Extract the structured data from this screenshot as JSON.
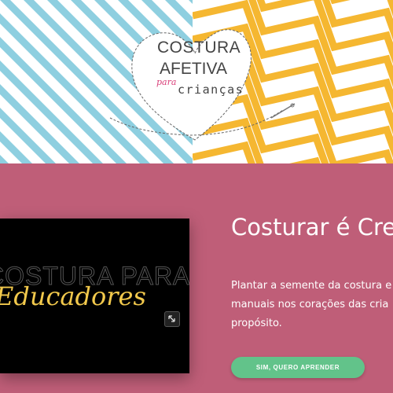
{
  "hero": {
    "logo": {
      "line1": "COSTURA",
      "line2": "AFETIVA",
      "line3": "para",
      "line4": "crianças"
    },
    "colors": {
      "stripes_left": "#8ecfe0",
      "stripes_right": "#f5b731",
      "heart_line": "#555555"
    }
  },
  "video": {
    "title_top": "COSTURA PARA",
    "title_bottom": "Educadores",
    "expand_icon": "expand-icon"
  },
  "main": {
    "heading": "Costurar é Cres",
    "paragraph_lines": [
      "Plantar a semente da costura e",
      "manuais nos corações das cria",
      "propósito."
    ],
    "cta_label": "SIM, QUERO APRENDER"
  },
  "colors": {
    "section_bg": "#bf5e78",
    "cta_bg": "#62c38a",
    "video_text": "#f2c94c"
  }
}
